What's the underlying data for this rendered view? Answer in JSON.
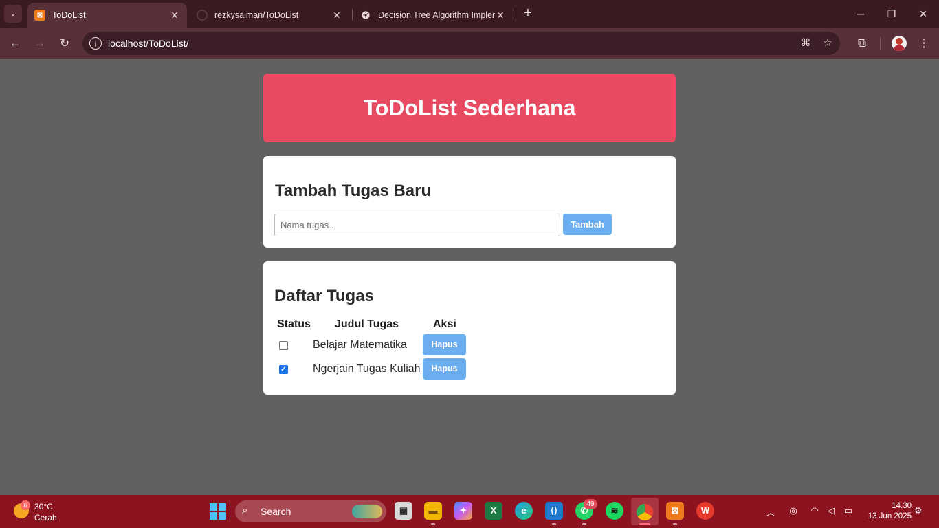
{
  "browser": {
    "tabs": [
      {
        "title": "ToDoList",
        "active": true
      },
      {
        "title": "rezkysalman/ToDoList",
        "active": false
      },
      {
        "title": "Decision Tree Algorithm Implem",
        "active": false
      }
    ],
    "url": "localhost/ToDoList/"
  },
  "page": {
    "header_title": "ToDoList Sederhana",
    "add_section": {
      "title": "Tambah Tugas Baru",
      "input_placeholder": "Nama tugas...",
      "input_value": "",
      "add_button": "Tambah"
    },
    "list_section": {
      "title": "Daftar Tugas",
      "columns": [
        "Status",
        "Judul Tugas",
        "Aksi"
      ],
      "tasks": [
        {
          "title": "Belajar Matematika",
          "done": false,
          "action": "Hapus"
        },
        {
          "title": "Ngerjain Tugas Kuliah",
          "done": true,
          "action": "Hapus"
        }
      ]
    },
    "colors": {
      "header_bg": "#e84a61",
      "button_bg": "#6aaef0",
      "page_bg": "#616161"
    }
  },
  "taskbar": {
    "weather": {
      "badge": "6",
      "temp": "30°C",
      "condition": "Cerah"
    },
    "search_label": "Search",
    "whatsapp_badge": "49",
    "time": "14.30",
    "date": "13 Jun 2025"
  }
}
